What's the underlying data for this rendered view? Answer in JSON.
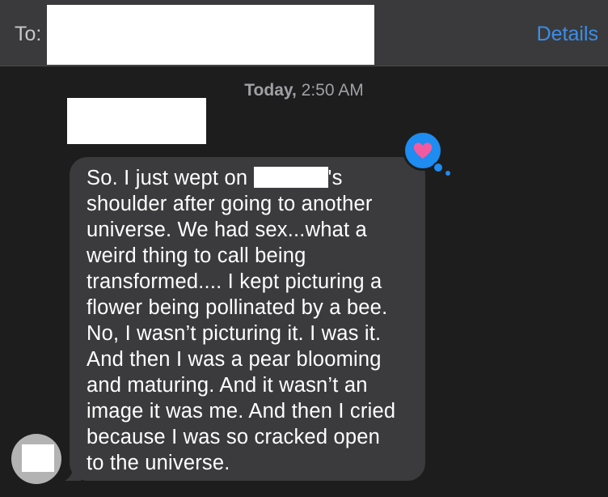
{
  "header": {
    "to_label": "To:",
    "details_label": "Details"
  },
  "conversation": {
    "timestamp_day": "Today,",
    "timestamp_time": "2:50 AM"
  },
  "message": {
    "text_before_redaction": "So. I just wept on ",
    "text_after_redaction": "'s\nshoulder after going to another\nuniverse. We had sex...what a\nweird thing to call being\ntransformed.... I kept picturing a\nflower being pollinated by a bee.\nNo, I wasn’t picturing it. I was it.\nAnd then I was a pear blooming\nand maturing. And it wasn’t an\nimage it was me. And then I cried\nbecause I was so cracked open\nto the universe.",
    "reaction_icon": "heart-reaction-icon"
  },
  "colors": {
    "background": "#1d1d1d",
    "header_bg": "#3a3a3c",
    "bubble_bg": "#3b3b3d",
    "accent_blue": "#3b8ee8",
    "heart_pink": "#f25ba0",
    "reaction_blue": "#1e8cf0"
  }
}
